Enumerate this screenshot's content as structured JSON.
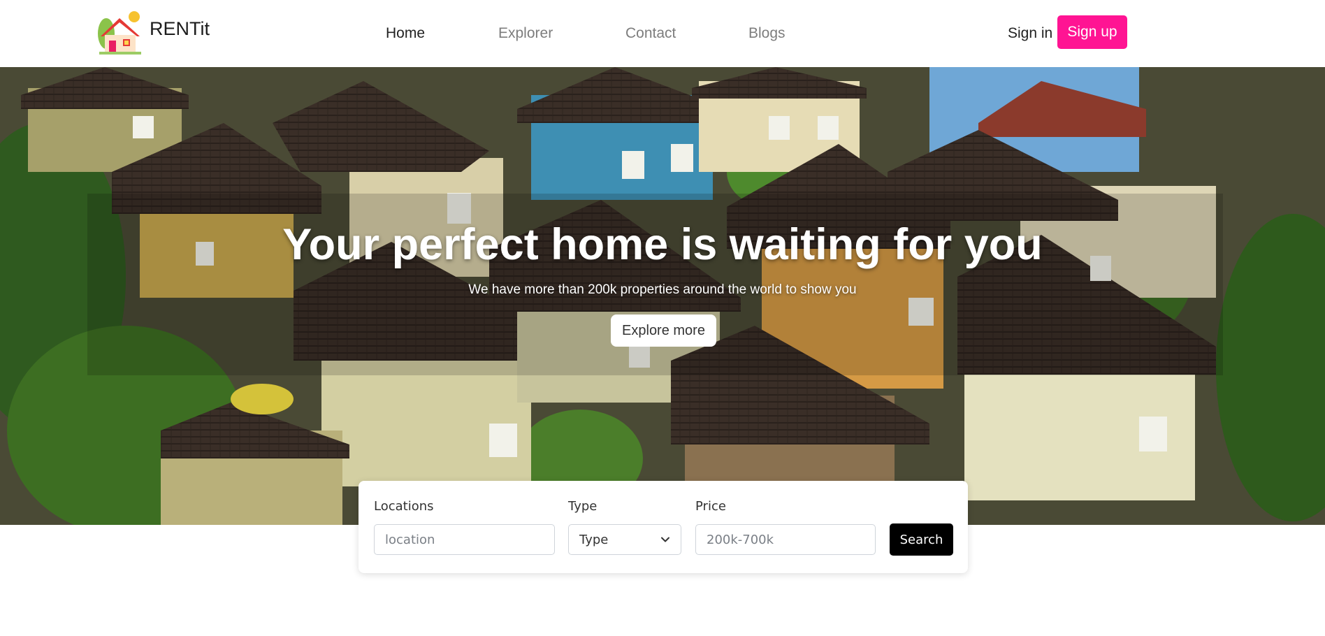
{
  "brand": {
    "name": "RENTit",
    "logo_icon": "house-logo-icon"
  },
  "nav": {
    "items": [
      {
        "label": "Home",
        "active": true
      },
      {
        "label": "Explorer",
        "active": false
      },
      {
        "label": "Contact",
        "active": false
      },
      {
        "label": "Blogs",
        "active": false
      }
    ],
    "signin_label": "Sign in",
    "signup_label": "Sign up"
  },
  "hero": {
    "title": "Your perfect home is waiting for you",
    "subtitle": "We have more than 200k properties around the world to show you",
    "cta_label": "Explore more"
  },
  "search": {
    "location": {
      "label": "Locations",
      "placeholder": "location"
    },
    "type": {
      "label": "Type",
      "selected": "Type",
      "icon": "chevron-down-icon"
    },
    "price": {
      "label": "Price",
      "placeholder": "200k-700k"
    },
    "button_label": "Search"
  },
  "colors": {
    "accent": "#ff1493",
    "search_button": "#000000",
    "text_muted": "#7d7d7d"
  }
}
